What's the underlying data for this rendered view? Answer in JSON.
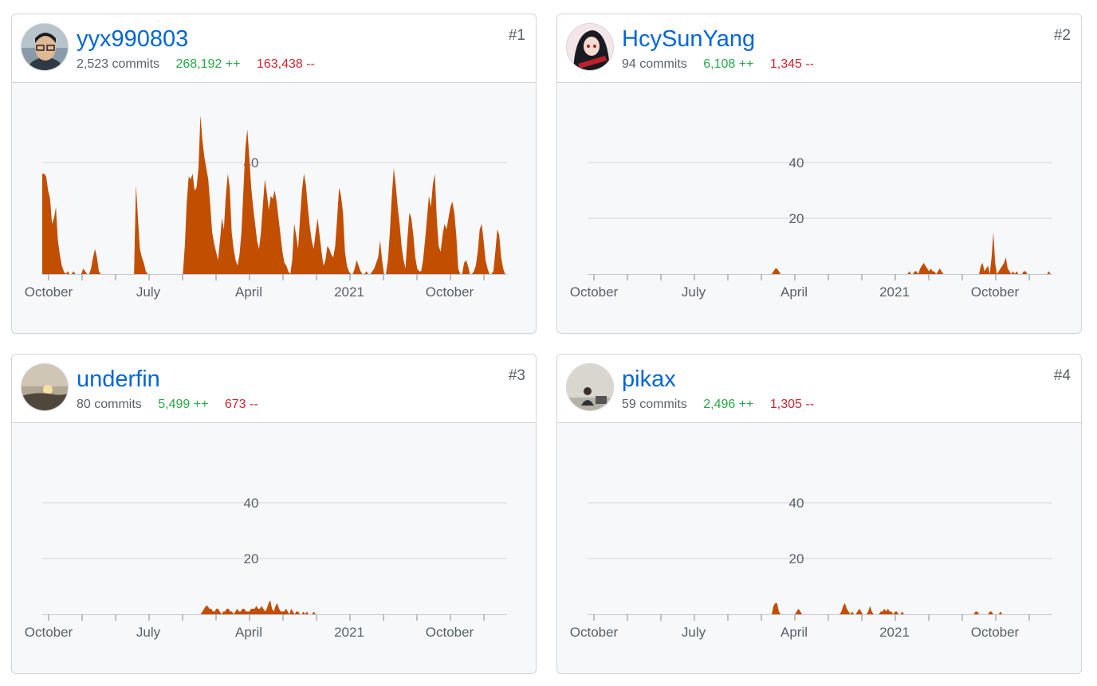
{
  "colors": {
    "link": "#0366d6",
    "additions": "#28a745",
    "deletions": "#cb2431",
    "area_fill": "#c24e00",
    "muted": "#586069",
    "grid": "#d1d5da"
  },
  "contributors": [
    {
      "username": "yyx990803",
      "rank": "#1",
      "commits": "2,523 commits",
      "additions": "268,192 ++",
      "deletions": "163,438 --",
      "avatar_icon": "avatar-person-glasses-icon",
      "chart_data": {
        "type": "area",
        "x_tick_labels": [
          "October",
          "July",
          "April",
          "2021",
          "October"
        ],
        "y_tick_labels": [
          "40"
        ],
        "y_ticks": [
          40
        ],
        "ylim": [
          0,
          57
        ],
        "grid": true,
        "values": [
          36,
          36,
          35,
          30,
          27,
          18,
          20,
          24,
          12,
          7,
          3,
          1,
          0,
          1,
          0,
          0,
          1,
          0,
          0,
          0,
          0,
          2,
          1,
          0,
          0,
          2,
          6,
          9,
          6,
          1,
          0,
          0,
          0,
          0,
          0,
          0,
          0,
          0,
          0,
          0,
          0,
          0,
          0,
          0,
          0,
          0,
          0,
          0,
          32,
          20,
          9,
          6,
          4,
          1,
          0,
          0,
          0,
          0,
          0,
          0,
          0,
          0,
          0,
          0,
          0,
          0,
          0,
          0,
          0,
          0,
          0,
          0,
          0,
          10,
          26,
          35,
          34,
          36,
          30,
          31,
          38,
          57,
          48,
          42,
          38,
          34,
          25,
          15,
          11,
          8,
          5,
          12,
          20,
          16,
          28,
          36,
          31,
          15,
          9,
          5,
          3,
          7,
          15,
          30,
          45,
          52,
          42,
          31,
          24,
          18,
          12,
          9,
          15,
          25,
          34,
          29,
          23,
          28,
          27,
          30,
          26,
          20,
          14,
          8,
          4,
          3,
          1,
          0,
          5,
          18,
          14,
          9,
          20,
          30,
          36,
          32,
          24,
          17,
          12,
          9,
          15,
          20,
          14,
          8,
          3,
          5,
          10,
          9,
          7,
          6,
          10,
          20,
          31,
          28,
          22,
          8,
          3,
          1,
          0,
          0,
          2,
          5,
          3,
          1,
          0,
          0,
          1,
          0,
          0,
          1,
          2,
          4,
          6,
          12,
          5,
          0,
          0,
          5,
          15,
          28,
          38,
          32,
          24,
          18,
          10,
          5,
          2,
          13,
          22,
          20,
          14,
          6,
          2,
          1,
          1,
          5,
          12,
          20,
          28,
          24,
          32,
          36,
          20,
          10,
          8,
          14,
          18,
          16,
          20,
          24,
          26,
          22,
          14,
          2,
          0,
          0,
          4,
          5,
          3,
          0,
          0,
          1,
          3,
          8,
          16,
          18,
          12,
          5,
          2,
          0,
          0,
          1,
          8,
          16,
          14,
          6,
          2,
          0,
          0
        ]
      }
    },
    {
      "username": "HcySunYang",
      "rank": "#2",
      "commits": "94 commits",
      "additions": "6,108 ++",
      "deletions": "1,345 --",
      "avatar_icon": "avatar-anime-character-icon",
      "chart_data": {
        "type": "area",
        "x_tick_labels": [
          "October",
          "July",
          "April",
          "2021",
          "October"
        ],
        "y_tick_labels": [
          "40",
          "20"
        ],
        "y_ticks": [
          40,
          20
        ],
        "ylim": [
          0,
          57
        ],
        "grid": true,
        "values": [
          0,
          0,
          0,
          0,
          0,
          0,
          0,
          0,
          0,
          0,
          0,
          0,
          0,
          0,
          0,
          0,
          0,
          0,
          0,
          0,
          0,
          0,
          0,
          0,
          0,
          0,
          0,
          0,
          0,
          0,
          0,
          0,
          0,
          0,
          0,
          0,
          0,
          0,
          0,
          0,
          0,
          0,
          0,
          0,
          0,
          0,
          0,
          0,
          0,
          0,
          0,
          0,
          0,
          0,
          0,
          0,
          0,
          0,
          0,
          0,
          0,
          0,
          0,
          0,
          0,
          0,
          0,
          0,
          0,
          0,
          0,
          0,
          0,
          0,
          0,
          0,
          0,
          0,
          0,
          0,
          0,
          0,
          0,
          0,
          0,
          0,
          0,
          0,
          0,
          0,
          0,
          0,
          0,
          0,
          0,
          0,
          0,
          0,
          0,
          0,
          0,
          0,
          0,
          0,
          1,
          2,
          2,
          1,
          0,
          0,
          0,
          0,
          0,
          0,
          0,
          0,
          0,
          0,
          0,
          0,
          0,
          0,
          0,
          0,
          0,
          0,
          0,
          0,
          0,
          0,
          0,
          0,
          0,
          0,
          0,
          0,
          0,
          0,
          0,
          0,
          0,
          0,
          0,
          0,
          0,
          0,
          0,
          0,
          0,
          0,
          0,
          0,
          0,
          0,
          0,
          0,
          0,
          0,
          0,
          0,
          0,
          0,
          0,
          0,
          0,
          0,
          0,
          0,
          0,
          0,
          0,
          0,
          0,
          0,
          0,
          0,
          0,
          0,
          0,
          0,
          1,
          0,
          0,
          1,
          1,
          0,
          2,
          3,
          4,
          3,
          2,
          1,
          2,
          1,
          1,
          0,
          1,
          2,
          1,
          0,
          0,
          0,
          0,
          0,
          0,
          0,
          0,
          0,
          0,
          0,
          0,
          0,
          0,
          0,
          0,
          0,
          0,
          0,
          0,
          0,
          3,
          4,
          1,
          2,
          3,
          0,
          6,
          15,
          4,
          0,
          1,
          2,
          3,
          4,
          6,
          2,
          1,
          0,
          1,
          0,
          1,
          0,
          0,
          0,
          1,
          1,
          0,
          0,
          0,
          0,
          0,
          0,
          0,
          0,
          0,
          0,
          0,
          0,
          1,
          0,
          0
        ]
      }
    },
    {
      "username": "underfin",
      "rank": "#3",
      "commits": "80 commits",
      "additions": "5,499 ++",
      "deletions": "673 --",
      "avatar_icon": "avatar-sunset-icon",
      "chart_data": {
        "type": "area",
        "x_tick_labels": [
          "October",
          "July",
          "April",
          "2021",
          "October"
        ],
        "y_tick_labels": [
          "40",
          "20"
        ],
        "y_ticks": [
          40,
          20
        ],
        "ylim": [
          0,
          57
        ],
        "grid": true,
        "values": [
          0,
          0,
          0,
          0,
          0,
          0,
          0,
          0,
          0,
          0,
          0,
          0,
          0,
          0,
          0,
          0,
          0,
          0,
          0,
          0,
          0,
          0,
          0,
          0,
          0,
          0,
          0,
          0,
          0,
          0,
          0,
          0,
          0,
          0,
          0,
          0,
          0,
          0,
          0,
          0,
          0,
          0,
          0,
          0,
          0,
          0,
          0,
          0,
          0,
          0,
          0,
          0,
          0,
          0,
          0,
          0,
          0,
          0,
          0,
          0,
          0,
          0,
          0,
          0,
          0,
          0,
          0,
          0,
          0,
          0,
          0,
          0,
          0,
          0,
          0,
          0,
          0,
          0,
          0,
          0,
          0,
          0,
          0,
          0,
          0,
          0,
          0,
          0,
          0,
          0,
          0,
          0,
          1,
          2,
          3,
          3,
          2,
          2,
          1,
          1,
          2,
          2,
          1,
          0,
          1,
          1,
          2,
          2,
          1,
          1,
          0,
          1,
          2,
          1,
          1,
          2,
          2,
          1,
          1,
          1,
          2,
          2,
          2,
          3,
          2,
          2,
          3,
          2,
          1,
          2,
          4,
          5,
          2,
          1,
          3,
          4,
          2,
          1,
          1,
          1,
          2,
          1,
          0,
          2,
          1,
          0,
          1,
          1,
          0,
          0,
          1,
          0,
          1,
          0,
          0,
          0,
          1,
          0,
          0,
          0,
          0,
          0,
          0,
          0,
          0,
          0,
          0,
          0,
          0,
          0,
          0,
          0,
          0,
          0,
          0,
          0,
          0,
          0,
          0,
          0,
          0,
          0,
          0,
          0,
          0,
          0,
          0,
          0,
          0,
          0,
          0,
          0,
          0,
          0,
          0,
          0,
          0,
          0,
          0,
          0,
          0,
          0,
          0,
          0,
          0,
          0,
          0,
          0,
          0,
          0,
          0,
          0,
          0,
          0,
          0,
          0,
          0,
          0,
          0,
          0,
          0,
          0,
          0,
          0,
          0,
          0,
          0,
          0,
          0,
          0,
          0,
          0,
          0,
          0,
          0,
          0,
          0,
          0,
          0,
          0,
          0,
          0,
          0,
          0,
          0,
          0,
          0,
          0,
          0,
          0,
          0,
          0,
          0,
          0,
          0,
          0,
          0,
          0,
          0,
          0,
          0,
          0,
          0,
          0,
          0,
          0,
          0,
          0
        ]
      }
    },
    {
      "username": "pikax",
      "rank": "#4",
      "commits": "59 commits",
      "additions": "2,496 ++",
      "deletions": "1,305 --",
      "avatar_icon": "avatar-person-desk-icon",
      "chart_data": {
        "type": "area",
        "x_tick_labels": [
          "October",
          "July",
          "April",
          "2021",
          "October"
        ],
        "y_tick_labels": [
          "40",
          "20"
        ],
        "y_ticks": [
          40,
          20
        ],
        "ylim": [
          0,
          57
        ],
        "grid": true,
        "values": [
          0,
          0,
          0,
          0,
          0,
          0,
          0,
          0,
          0,
          0,
          0,
          0,
          0,
          0,
          0,
          0,
          0,
          0,
          0,
          0,
          0,
          0,
          0,
          0,
          0,
          0,
          0,
          0,
          0,
          0,
          0,
          0,
          0,
          0,
          0,
          0,
          0,
          0,
          0,
          0,
          0,
          0,
          0,
          0,
          0,
          0,
          0,
          0,
          0,
          0,
          0,
          0,
          0,
          0,
          0,
          0,
          0,
          0,
          0,
          0,
          0,
          0,
          0,
          0,
          0,
          0,
          0,
          0,
          0,
          0,
          0,
          0,
          0,
          0,
          0,
          0,
          0,
          0,
          0,
          0,
          0,
          0,
          0,
          0,
          0,
          0,
          0,
          0,
          0,
          0,
          0,
          0,
          0,
          0,
          0,
          0,
          0,
          0,
          0,
          0,
          0,
          0,
          0,
          0,
          3,
          4,
          4,
          1,
          0,
          0,
          0,
          0,
          0,
          0,
          0,
          0,
          0,
          1,
          2,
          1,
          0,
          0,
          0,
          0,
          0,
          0,
          0,
          0,
          0,
          0,
          0,
          0,
          0,
          0,
          0,
          0,
          0,
          0,
          0,
          0,
          0,
          0,
          1,
          3,
          4,
          2,
          1,
          0,
          1,
          0,
          0,
          1,
          2,
          1,
          0,
          0,
          0,
          1,
          3,
          1,
          0,
          0,
          0,
          0,
          1,
          1,
          2,
          1,
          2,
          1,
          1,
          0,
          1,
          1,
          0,
          0,
          1,
          0,
          0,
          0,
          0,
          0,
          0,
          0,
          0,
          0,
          0,
          0,
          0,
          0,
          0,
          0,
          0,
          0,
          0,
          0,
          0,
          0,
          0,
          0,
          0,
          0,
          0,
          0,
          0,
          0,
          0,
          0,
          0,
          0,
          0,
          0,
          0,
          0,
          0,
          0,
          0,
          1,
          1,
          0,
          0,
          0,
          0,
          0,
          0,
          1,
          1,
          0,
          0,
          0,
          0,
          1,
          0,
          0,
          0,
          0,
          0,
          0,
          0,
          0,
          0,
          0,
          0,
          0,
          0,
          0,
          0,
          0,
          0,
          0,
          0,
          0,
          0,
          0,
          0,
          0,
          0,
          0,
          0,
          0,
          0
        ]
      }
    }
  ]
}
